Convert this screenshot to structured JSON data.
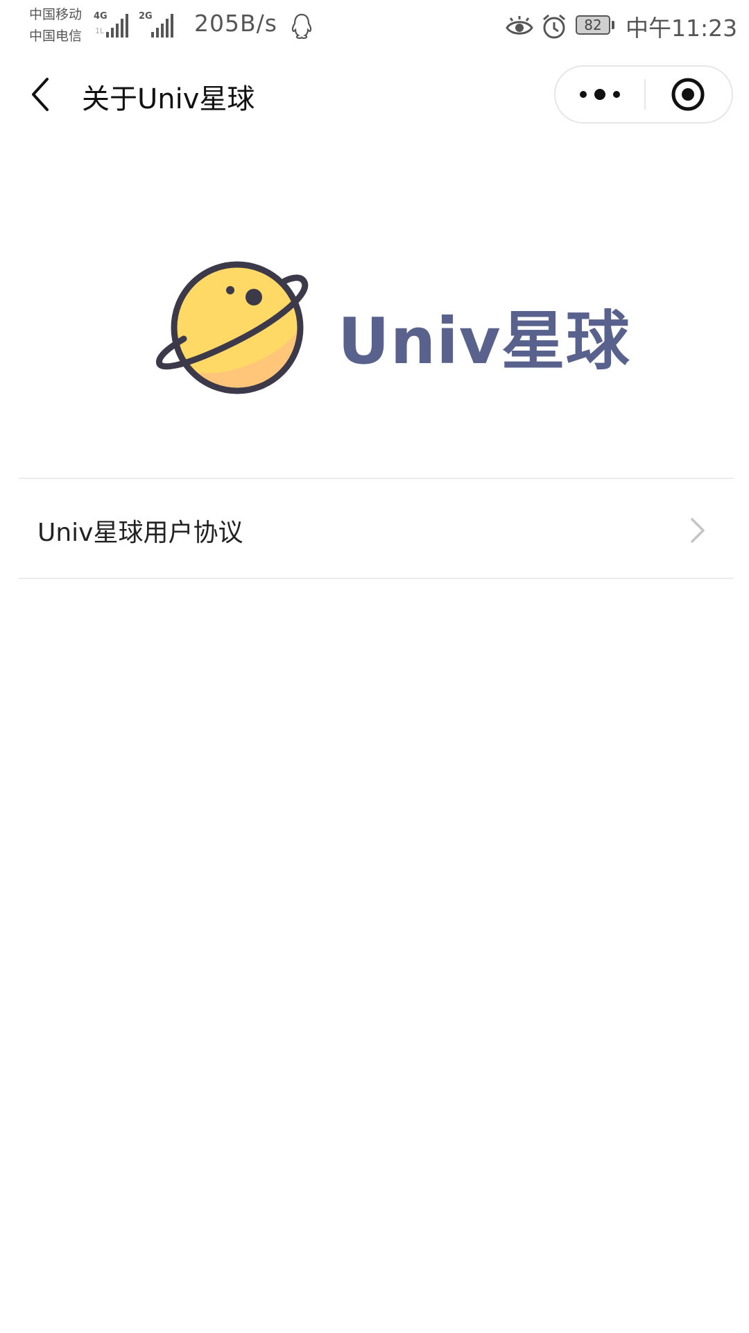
{
  "status_bar": {
    "carrier_1": "中国移动",
    "carrier_2": "中国电信",
    "network_1": "4G",
    "network_1_sub": "1L",
    "network_2": "2G",
    "speed": "205B/s",
    "battery_level": "82",
    "time": "中午11:23"
  },
  "nav": {
    "title": "关于Univ星球",
    "icons": {
      "back": "chevron-left-icon",
      "more": "more-icon",
      "close": "target-icon"
    }
  },
  "logo": {
    "text": "Univ星球",
    "icon": "planet-icon",
    "colors": {
      "text": "#58628c",
      "planet_fill": "#ffd966",
      "planet_shade": "#ffc27a",
      "outline": "#3c3a4a"
    }
  },
  "menu": {
    "items": [
      {
        "label": "Univ星球用户协议",
        "icon": "chevron-right-icon"
      }
    ]
  }
}
